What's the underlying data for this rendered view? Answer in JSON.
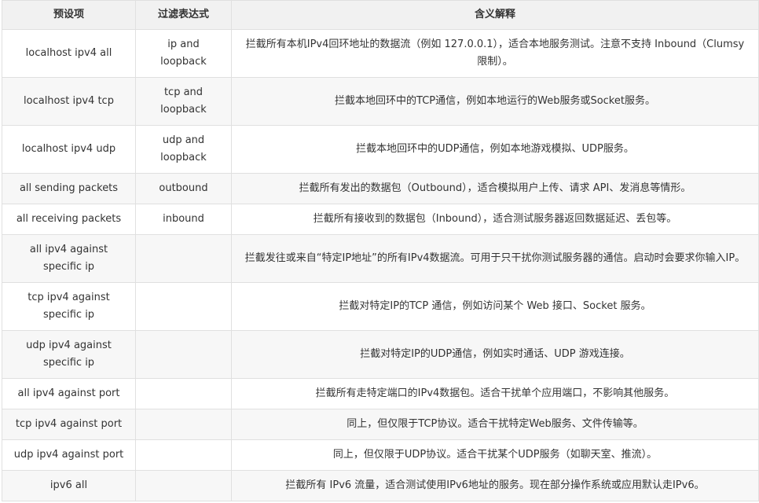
{
  "table": {
    "headers": [
      "预设项",
      "过滤表达式",
      "含义解释"
    ],
    "rows": [
      {
        "preset": "localhost ipv4 all",
        "filter": "ip and loopback",
        "desc": "拦截所有本机IPv4回环地址的数据流（例如 127.0.0.1），适合本地服务测试。注意不支持 Inbound（Clumsy 限制）。"
      },
      {
        "preset": "localhost ipv4 tcp",
        "filter": "tcp and loopback",
        "desc": "拦截本地回环中的TCP通信，例如本地运行的Web服务或Socket服务。"
      },
      {
        "preset": "localhost ipv4 udp",
        "filter": "udp and loopback",
        "desc": "拦截本地回环中的UDP通信，例如本地游戏模拟、UDP服务。"
      },
      {
        "preset": "all sending packets",
        "filter": "outbound",
        "desc": "拦截所有发出的数据包（Outbound），适合模拟用户上传、请求 API、发消息等情形。"
      },
      {
        "preset": "all receiving packets",
        "filter": "inbound",
        "desc": "拦截所有接收到的数据包（Inbound），适合测试服务器返回数据延迟、丢包等。"
      },
      {
        "preset": "all ipv4 against specific ip",
        "filter": "",
        "desc": "拦截发往或来自“特定IP地址”的所有IPv4数据流。可用于只干扰你测试服务器的通信。启动时会要求你输入IP。"
      },
      {
        "preset": "tcp ipv4 against specific ip",
        "filter": "",
        "desc": "拦截对特定IP的TCP 通信，例如访问某个 Web 接口、Socket 服务。"
      },
      {
        "preset": "udp ipv4 against specific ip",
        "filter": "",
        "desc": "拦截对特定IP的UDP通信，例如实时通话、UDP 游戏连接。"
      },
      {
        "preset": "all ipv4 against port",
        "filter": "",
        "desc": "拦截所有走特定端口的IPv4数据包。适合干扰单个应用端口，不影响其他服务。"
      },
      {
        "preset": "tcp ipv4 against port",
        "filter": "",
        "desc": "同上，但仅限于TCP协议。适合干扰特定Web服务、文件传输等。"
      },
      {
        "preset": "udp ipv4 against port",
        "filter": "",
        "desc": "同上，但仅限于UDP协议。适合干扰某个UDP服务（如聊天室、推流）。"
      },
      {
        "preset": "ipv6 all",
        "filter": "",
        "desc": "拦截所有 IPv6 流量，适合测试使用IPv6地址的服务。现在部分操作系统或应用默认走IPv6。"
      }
    ]
  }
}
